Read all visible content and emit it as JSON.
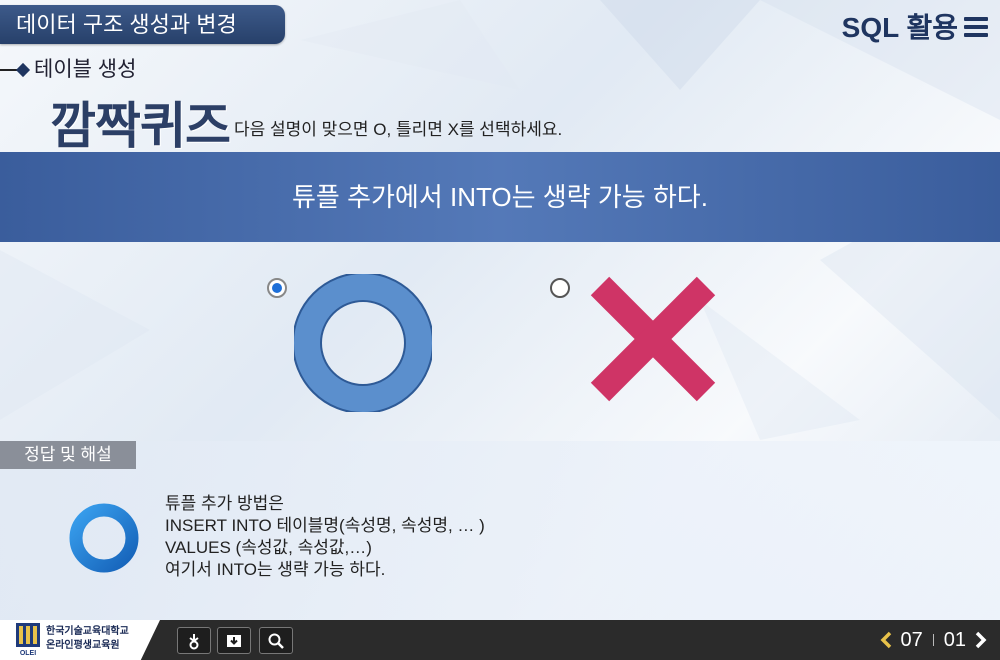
{
  "header": {
    "chapter_title": "데이터 구조 생성과 변경",
    "course_label": "SQL 활용"
  },
  "section": {
    "label": "테이블 생성"
  },
  "quiz": {
    "title": "깜짝퀴즈",
    "instruction": "다음 설명이 맞으면 O, 틀리면 X를 선택하세요.",
    "question": "튜플 추가에서 INTO는 생략 가능 하다.",
    "options": [
      {
        "label": "O",
        "selected": true,
        "color": "#5b8fcd"
      },
      {
        "label": "X",
        "selected": false,
        "color": "#cf3466"
      }
    ]
  },
  "answer": {
    "tab_label": "정답 및 해설",
    "correct_symbol": "O",
    "lines": [
      "튜플 추가 방법은",
      "INSERT INTO 테이블명(속성명, 속성명, … )",
      "VALUES  (속성값, 속성값,…)",
      "여기서 INTO는 생략 가능 하다."
    ]
  },
  "footer": {
    "logo_line1": "한국기술교육대학교",
    "logo_line2": "온라인평생교육원",
    "logo_mark": "OLEI",
    "tools": [
      "bookmark-icon",
      "download-icon",
      "search-icon"
    ],
    "current_page": "07",
    "total_pages": "01"
  },
  "colors": {
    "header_tab": "#2f4a78",
    "banner": "#4a6eae",
    "o_mark": "#5b8fcd",
    "x_mark": "#cf3466",
    "answer_ring": "#1e7fd6"
  }
}
